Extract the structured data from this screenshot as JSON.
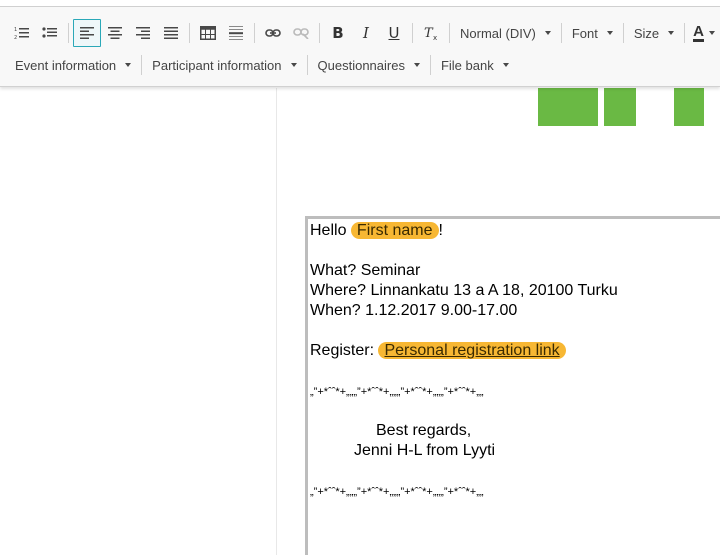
{
  "toolbar": {
    "format_combo": {
      "label": "Normal (DIV)"
    },
    "font_combo": {
      "label": "Font"
    },
    "size_combo": {
      "label": "Size"
    },
    "bold_glyph": "B",
    "italic_glyph": "I",
    "underline_glyph": "U",
    "text_color_glyph": "A",
    "insert_menus": [
      {
        "label": "Event information"
      },
      {
        "label": "Participant information"
      },
      {
        "label": "Questionnaires"
      },
      {
        "label": "File bank"
      }
    ]
  },
  "logo_color": "#6ab944",
  "accent_color": "#f7b733",
  "email": {
    "greeting_prefix": "Hello",
    "first_name_token": "First name",
    "greeting_suffix": "!",
    "what": "What? Seminar",
    "where": "Where? Linnankatu 13 a A 18, 20100 Turku",
    "when": "When? 1.12.2017 9.00-17.00",
    "register_prefix": "Register:",
    "registration_link_token": "Personal registration link",
    "decoration": "„”+*ˆˆ*+„„„”+*ˆˆ*+„„„”+*ˆˆ*+„„„”+*ˆˆ*+„„",
    "regards": "Best regards,",
    "signature": "Jenni H-L from Lyyti"
  }
}
